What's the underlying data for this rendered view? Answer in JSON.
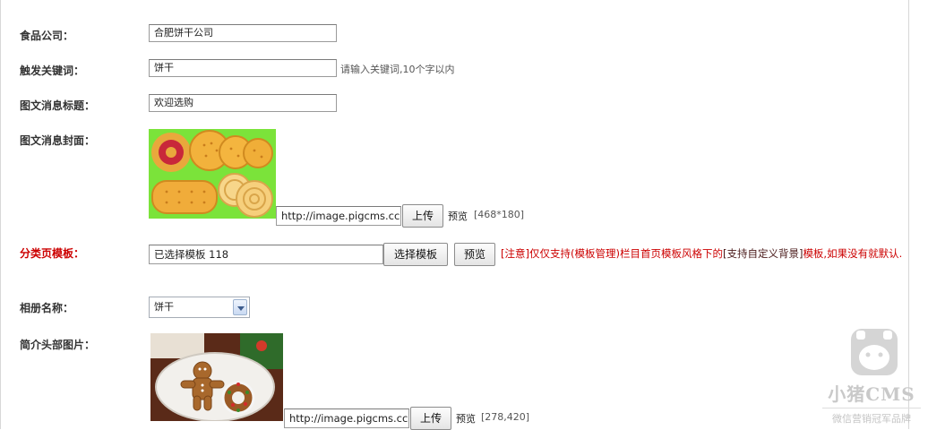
{
  "fields": {
    "company": {
      "label": "食品公司：",
      "value": "合肥饼干公司"
    },
    "keyword": {
      "label": "触发关键词：",
      "value": "饼干",
      "hint": "请输入关键词,10个字以内"
    },
    "news_title": {
      "label": "图文消息标题：",
      "value": "欢迎选购"
    },
    "cover": {
      "label": "图文消息封面：",
      "url_value": "http://image.pigcms.cc",
      "upload_label": "上传",
      "preview_text": "预览",
      "size_hint": "[468*180]"
    },
    "template": {
      "label": "分类页模板：",
      "value": "已选择模板 118",
      "choose_label": "选择模板",
      "preview_label": "预览",
      "notice_a": "[注意]仅仅支持(模板管理)栏目首页模板风格下的",
      "notice_b": "[支持自定义背景]",
      "notice_c": "模板,如果没有就默认."
    },
    "album": {
      "label": "相册名称：",
      "selected": "饼干"
    },
    "intro_image": {
      "label": "简介头部图片：",
      "url_value": "http://image.pigcms.cc",
      "upload_label": "上传",
      "preview_text": "预览",
      "size_hint": "[278,420]"
    }
  },
  "watermark": {
    "brand": "小猪CMS",
    "slogan": "微信营销冠军品牌"
  },
  "colors": {
    "required_label": "#cc0000",
    "notice": "#cc0000",
    "cover_bg": "#7be33a",
    "select_arrow": "#3b5b8c"
  },
  "icons": {
    "dropdown": "chevron-down-icon",
    "watermark": "pig-face-icon"
  }
}
